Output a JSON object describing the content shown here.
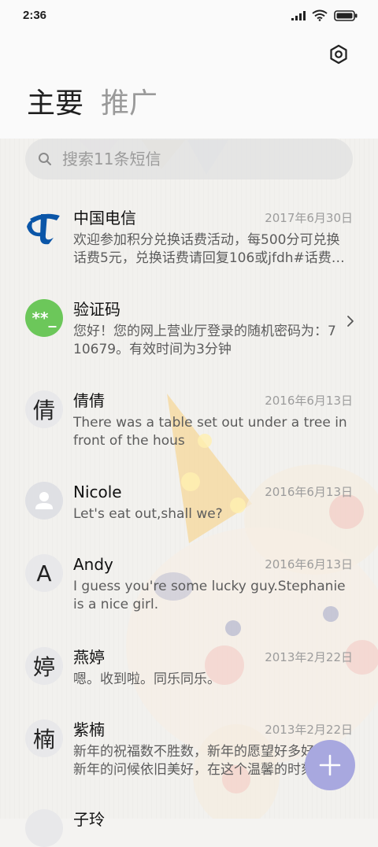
{
  "status_bar": {
    "time": "2:36"
  },
  "header": {
    "settings_icon": "gear-hexagon-icon"
  },
  "tabs": [
    {
      "label": "主要",
      "active": true
    },
    {
      "label": "推广",
      "active": false
    }
  ],
  "search": {
    "placeholder": "搜索11条短信"
  },
  "conversations": [
    {
      "name": "中国电信",
      "date": "2017年6月30日",
      "preview": "欢迎参加积分兑换话费活动，每500分可兑换话费5元，兑换话费请回复106或jfdh#话费…",
      "avatar": {
        "type": "logo",
        "icon": "china-telecom-logo-icon"
      }
    },
    {
      "name": "验证码",
      "date": "",
      "preview": "您好！您的网上营业厅登录的随机密码为：710679。有效时间为3分钟",
      "avatar": {
        "type": "code",
        "text": "**_"
      }
    },
    {
      "name": "倩倩",
      "date": "2016年6月13日",
      "preview": "There was a table set out under a tree in front of the hous",
      "avatar": {
        "type": "letter",
        "text": "倩"
      }
    },
    {
      "name": "Nicole",
      "date": "2016年6月13日",
      "preview": "Let's eat out,shall we?",
      "avatar": {
        "type": "person",
        "icon": "person-icon"
      }
    },
    {
      "name": "Andy",
      "date": "2016年6月13日",
      "preview": "I guess you're some lucky guy.Stephanie is a nice girl.",
      "avatar": {
        "type": "letter",
        "text": "A"
      }
    },
    {
      "name": "燕婷",
      "date": "2013年2月22日",
      "preview": "嗯。收到啦。同乐同乐。",
      "avatar": {
        "type": "letter",
        "text": "婷"
      }
    },
    {
      "name": "紫楠",
      "date": "2013年2月22日",
      "preview": "新年的祝福数不胜数，新年的愿望好多好多，新年的问候依旧美好，在这个温馨的时刻",
      "avatar": {
        "type": "letter",
        "text": "楠"
      }
    },
    {
      "name": "子玲",
      "date": "",
      "preview": "",
      "avatar": {
        "type": "letter",
        "text": ""
      }
    }
  ],
  "fab": {
    "icon": "plus-icon",
    "color": "#a8a8df"
  },
  "colors": {
    "accent_green": "#6cc75a",
    "telecom_blue": "#0b56a8"
  }
}
